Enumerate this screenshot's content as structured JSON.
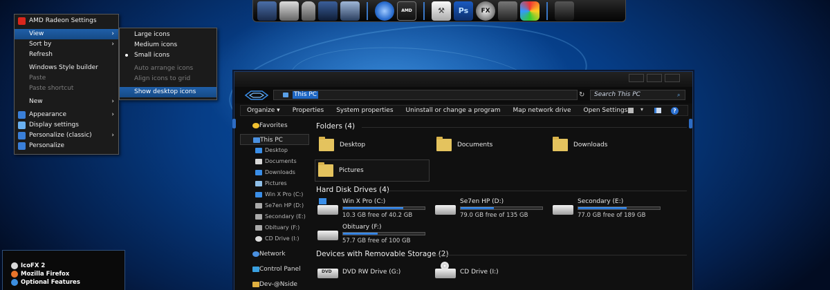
{
  "context_menu": {
    "items": [
      {
        "label": "AMD Radeon Settings",
        "icon": "amd-radeon-icon",
        "color": "#d9261c"
      },
      {
        "label": "View",
        "submenu": true,
        "highlight": true
      },
      {
        "label": "Sort by",
        "submenu": true
      },
      {
        "label": "Refresh"
      },
      {
        "label": "Windows Style builder"
      },
      {
        "label": "Paste",
        "disabled": true
      },
      {
        "label": "Paste shortcut",
        "disabled": true
      },
      {
        "label": "New",
        "submenu": true
      },
      {
        "label": "Appearance",
        "submenu": true,
        "icon": "appearance-icon"
      },
      {
        "label": "Display settings",
        "icon": "display-icon"
      },
      {
        "label": "Personalize (classic)",
        "submenu": true,
        "icon": "personalize-icon"
      },
      {
        "label": "Personalize",
        "icon": "personalize-icon"
      }
    ]
  },
  "view_submenu": {
    "items": [
      {
        "label": "Large icons"
      },
      {
        "label": "Medium icons"
      },
      {
        "label": "Small icons",
        "checked": true
      },
      {
        "label": "Auto arrange icons",
        "disabled": true
      },
      {
        "label": "Align icons to grid",
        "disabled": true
      },
      {
        "label": "Show desktop icons",
        "highlight": true
      }
    ]
  },
  "dock": {
    "icons": [
      "app-icon",
      "app-icon",
      "trash-icon",
      "app-icon",
      "app-icon",
      "globe-icon",
      "amd-icon",
      "hammer-icon",
      "photoshop-icon",
      "fx-icon",
      "app-icon",
      "app-icon",
      "mass-effect-icon"
    ],
    "ps_label": "Ps",
    "fx_label": "FX"
  },
  "explorer": {
    "address": "This PC",
    "search_placeholder": "Search This PC",
    "toolbar": [
      "Organize ▾",
      "Properties",
      "System properties",
      "Uninstall or change a program",
      "Map network drive",
      "Open Settings"
    ],
    "nav": [
      {
        "label": "Favorites",
        "icon": "star-icon",
        "level": 0
      },
      {
        "label": "This PC",
        "icon": "computer-icon",
        "level": 0,
        "selected": true
      },
      {
        "label": "Desktop",
        "icon": "desktop-icon",
        "level": 1
      },
      {
        "label": "Documents",
        "icon": "documents-icon",
        "level": 1
      },
      {
        "label": "Downloads",
        "icon": "downloads-icon",
        "level": 1
      },
      {
        "label": "Pictures",
        "icon": "pictures-icon",
        "level": 1
      },
      {
        "label": "Win X Pro (C:)",
        "icon": "drive-icon",
        "level": 1
      },
      {
        "label": "Se7en HP (D:)",
        "icon": "drive-icon",
        "level": 1
      },
      {
        "label": "Secondary (E:)",
        "icon": "drive-icon",
        "level": 1
      },
      {
        "label": "Obituary (F:)",
        "icon": "drive-icon",
        "level": 1
      },
      {
        "label": "CD Drive (I:)",
        "icon": "cd-icon",
        "level": 1
      },
      {
        "label": "Network",
        "icon": "network-icon",
        "level": 0
      },
      {
        "label": "Control Panel",
        "icon": "control-panel-icon",
        "level": 0
      },
      {
        "label": "Dev-@Nside",
        "icon": "user-icon",
        "level": 0
      }
    ],
    "folders_header": "Folders (4)",
    "folders": [
      "Desktop",
      "Documents",
      "Downloads",
      "Pictures"
    ],
    "drives_header": "Hard Disk Drives (4)",
    "drives": [
      {
        "name": "Win X Pro (C:)",
        "free": "10.3 GB free of 40.2 GB",
        "used_fraction": 0.74
      },
      {
        "name": "Se7en HP (D:)",
        "free": "79.0 GB free of 135 GB",
        "used_fraction": 0.41
      },
      {
        "name": "Secondary (E:)",
        "free": "77.0 GB free of 189 GB",
        "used_fraction": 0.59
      },
      {
        "name": "Obituary (F:)",
        "free": "57.7 GB free of 100 GB",
        "used_fraction": 0.42
      }
    ],
    "removable_header": "Devices with Removable Storage (2)",
    "removable": [
      {
        "name": "DVD RW Drive (G:)",
        "badge": "DVD"
      },
      {
        "name": "CD Drive (I:)"
      }
    ]
  },
  "start_panel": {
    "items": [
      {
        "label": "IcoFX 2",
        "color": "#d9d9d9"
      },
      {
        "label": "Mozilla Firefox",
        "color": "#e8742a"
      },
      {
        "label": "Optional Features",
        "color": "#3c8fe0"
      }
    ]
  },
  "colors": {
    "accent": "#1f67c4",
    "menu_bg": "#1b1b1b",
    "window_bg": "#101010"
  }
}
